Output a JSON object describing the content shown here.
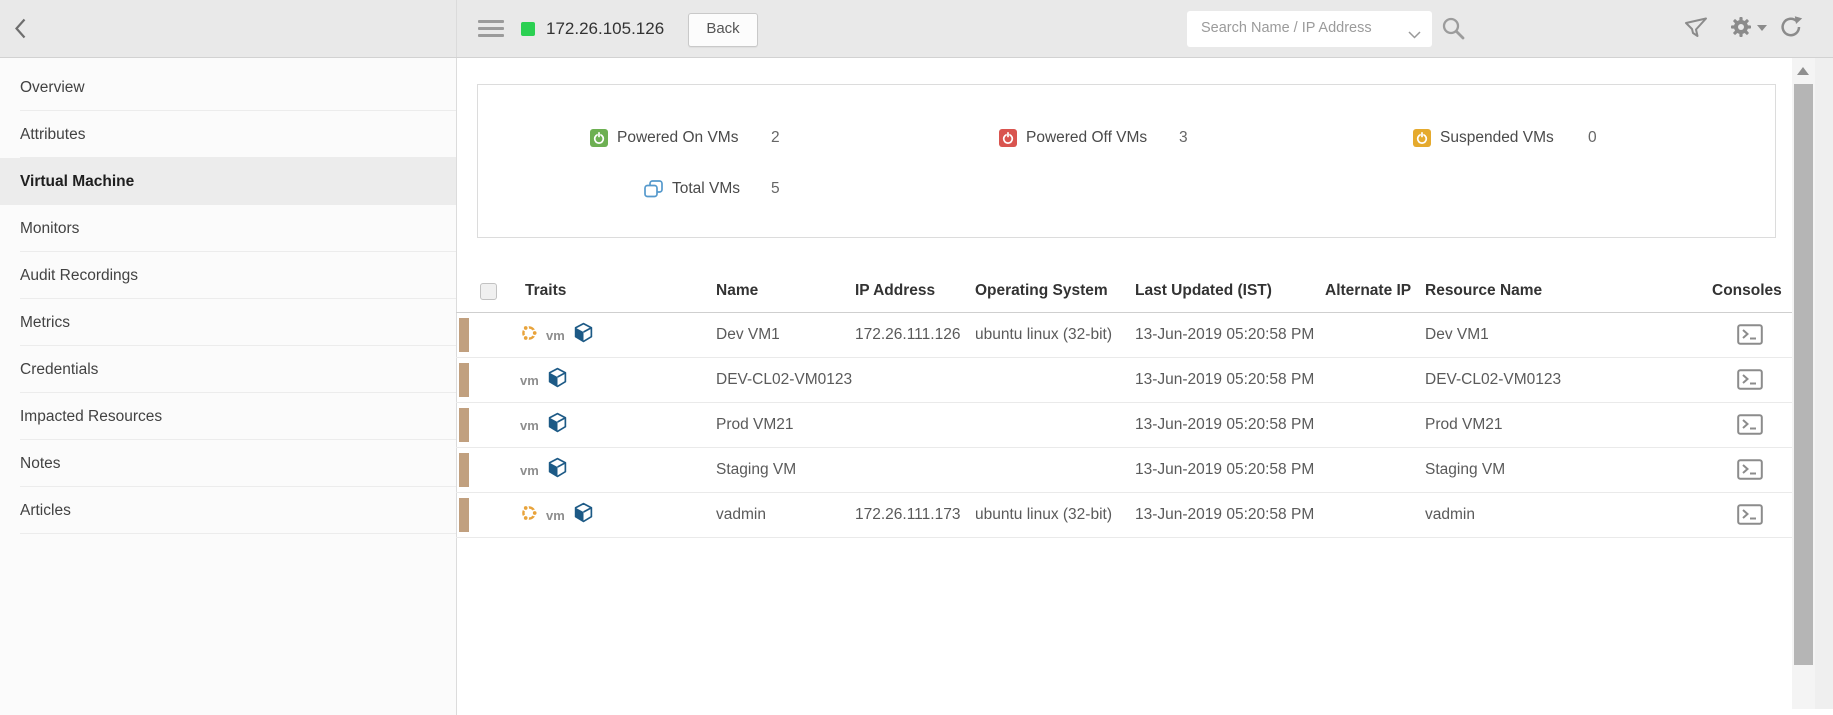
{
  "topbar": {
    "title": "172.26.105.126",
    "back_label": "Back",
    "search_placeholder": "Search Name / IP Address",
    "status_color": "#2bd052"
  },
  "sidebar": {
    "items": [
      {
        "label": "Overview",
        "selected": false
      },
      {
        "label": "Attributes",
        "selected": false
      },
      {
        "label": "Virtual Machine",
        "selected": true
      },
      {
        "label": "Monitors",
        "selected": false
      },
      {
        "label": "Audit Recordings",
        "selected": false
      },
      {
        "label": "Metrics",
        "selected": false
      },
      {
        "label": "Credentials",
        "selected": false
      },
      {
        "label": "Impacted Resources",
        "selected": false
      },
      {
        "label": "Notes",
        "selected": false
      },
      {
        "label": "Articles",
        "selected": false
      }
    ]
  },
  "summary": {
    "stats": [
      {
        "label": "Powered On VMs",
        "value": "2",
        "icon": "power-on-icon",
        "color": "#6db052"
      },
      {
        "label": "Powered Off VMs",
        "value": "3",
        "icon": "power-off-icon",
        "color": "#d9544f"
      },
      {
        "label": "Suspended VMs",
        "value": "0",
        "icon": "suspended-icon",
        "color": "#e5aa2e"
      },
      {
        "label": "Total VMs",
        "value": "5",
        "icon": "total-vms-icon",
        "color": "#5599cc"
      }
    ]
  },
  "table": {
    "columns": {
      "traits": "Traits",
      "name": "Name",
      "ip": "IP Address",
      "os": "Operating System",
      "updated": "Last Updated (IST)",
      "alternate_ip": "Alternate IP",
      "resource": "Resource Name",
      "consoles": "Consoles"
    },
    "vm_trait_label": "vm",
    "link_color": "#2e7cb0",
    "row_indicator_color": "#c1a07f",
    "rows": [
      {
        "name": "Dev VM1",
        "ip": "172.26.111.126",
        "os": "ubuntu linux (32-bit)",
        "updated": "13-Jun-2019 05:20:58 PM",
        "alternate_ip": "",
        "resource": "Dev VM1",
        "has_ubuntu_trait": true
      },
      {
        "name": "DEV-CL02-VM0123",
        "ip": "",
        "os": "",
        "updated": "13-Jun-2019 05:20:58 PM",
        "alternate_ip": "",
        "resource": "DEV-CL02-VM0123",
        "has_ubuntu_trait": false
      },
      {
        "name": "Prod VM21",
        "ip": "",
        "os": "",
        "updated": "13-Jun-2019 05:20:58 PM",
        "alternate_ip": "",
        "resource": "Prod VM21",
        "has_ubuntu_trait": false
      },
      {
        "name": "Staging VM",
        "ip": "",
        "os": "",
        "updated": "13-Jun-2019 05:20:58 PM",
        "alternate_ip": "",
        "resource": "Staging VM",
        "has_ubuntu_trait": false
      },
      {
        "name": "vadmin",
        "ip": "172.26.111.173",
        "os": "ubuntu linux (32-bit)",
        "updated": "13-Jun-2019 05:20:58 PM",
        "alternate_ip": "",
        "resource": "vadmin",
        "has_ubuntu_trait": true
      }
    ]
  }
}
